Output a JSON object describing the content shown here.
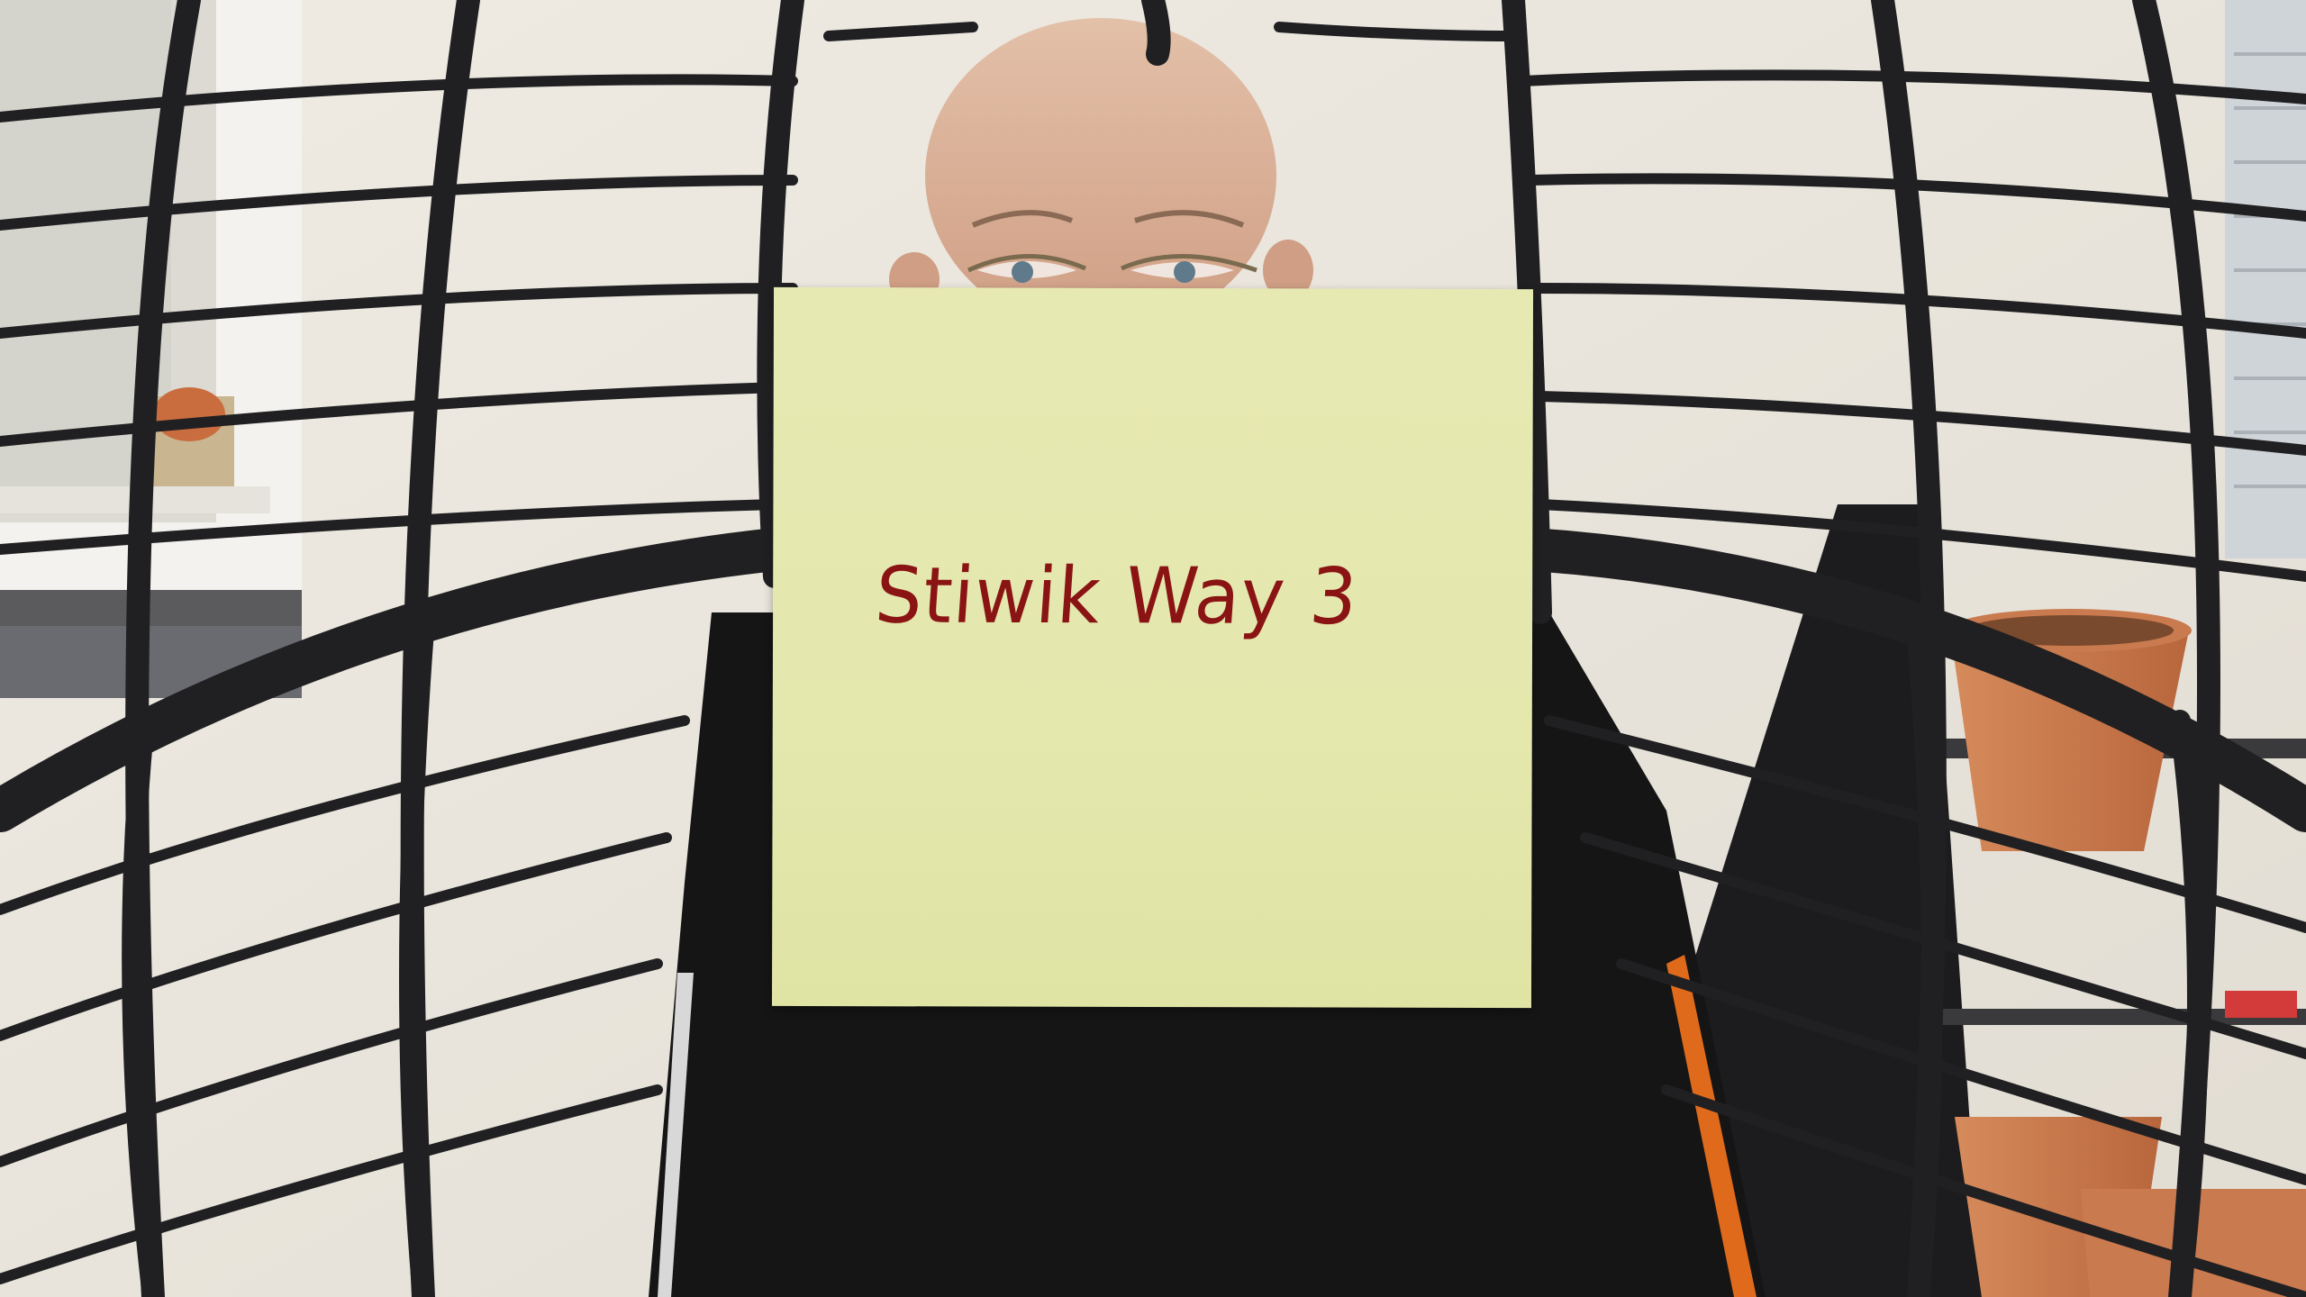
{
  "photo": {
    "note_text": "Stiwik Way 3",
    "colors": {
      "wall": "#ebe6dd",
      "wicker": "#1f1f20",
      "note_paper": "#e4e8ad",
      "note_ink": "#8a1414",
      "sweater": "#161616",
      "skin": "#d9b39a",
      "pot": "#c9774a"
    }
  }
}
